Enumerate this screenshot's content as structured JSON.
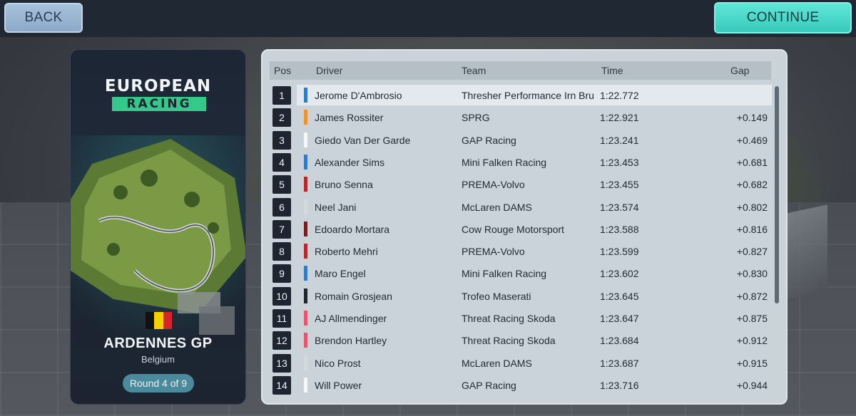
{
  "topbar": {
    "back_label": "BACK",
    "continue_label": "CONTINUE"
  },
  "event": {
    "series_line1": "EUROPEAN",
    "series_line2": "RACING",
    "gp_name": "ARDENNES GP",
    "country": "Belgium",
    "round_label": "Round 4 of 9",
    "flag_colors": [
      "#111111",
      "#f4d000",
      "#d9232b"
    ]
  },
  "results": {
    "headers": {
      "pos": "Pos",
      "driver": "Driver",
      "team": "Team",
      "time": "Time",
      "gap": "Gap"
    },
    "rows": [
      {
        "pos": "1",
        "driver": "Jerome D'Ambrosio",
        "team": "Thresher Performance Irn Bru",
        "time": "1:22.772",
        "gap": "",
        "color": "#2f7dc3"
      },
      {
        "pos": "2",
        "driver": "James Rossiter",
        "team": "SPRG",
        "time": "1:22.921",
        "gap": "+0.149",
        "color": "#f0922e"
      },
      {
        "pos": "3",
        "driver": "Giedo Van Der Garde",
        "team": "GAP Racing",
        "time": "1:23.241",
        "gap": "+0.469",
        "color": "#f4f6f7"
      },
      {
        "pos": "4",
        "driver": "Alexander Sims",
        "team": "Mini Falken Racing",
        "time": "1:23.453",
        "gap": "+0.681",
        "color": "#2f7dc3"
      },
      {
        "pos": "5",
        "driver": "Bruno Senna",
        "team": "PREMA-Volvo",
        "time": "1:23.455",
        "gap": "+0.682",
        "color": "#b22a2a"
      },
      {
        "pos": "6",
        "driver": "Neel Jani",
        "team": "McLaren DAMS",
        "time": "1:23.574",
        "gap": "+0.802",
        "color": "#d5dadd"
      },
      {
        "pos": "7",
        "driver": "Edoardo Mortara",
        "team": "Cow Rouge Motorsport",
        "time": "1:23.588",
        "gap": "+0.816",
        "color": "#7a1b1b"
      },
      {
        "pos": "8",
        "driver": "Roberto Mehri",
        "team": "PREMA-Volvo",
        "time": "1:23.599",
        "gap": "+0.827",
        "color": "#b22a2a"
      },
      {
        "pos": "9",
        "driver": "Maro Engel",
        "team": "Mini Falken Racing",
        "time": "1:23.602",
        "gap": "+0.830",
        "color": "#2f7dc3"
      },
      {
        "pos": "10",
        "driver": "Romain Grosjean",
        "team": "Trofeo Maserati",
        "time": "1:23.645",
        "gap": "+0.872",
        "color": "#1e2530"
      },
      {
        "pos": "11",
        "driver": "AJ Allmendinger",
        "team": "Threat Racing Skoda",
        "time": "1:23.647",
        "gap": "+0.875",
        "color": "#e8566a"
      },
      {
        "pos": "12",
        "driver": "Brendon Hartley",
        "team": "Threat Racing Skoda",
        "time": "1:23.684",
        "gap": "+0.912",
        "color": "#e8566a"
      },
      {
        "pos": "13",
        "driver": "Nico Prost",
        "team": "McLaren DAMS",
        "time": "1:23.687",
        "gap": "+0.915",
        "color": "#d5dadd"
      },
      {
        "pos": "14",
        "driver": "Will Power",
        "team": "GAP Racing",
        "time": "1:23.716",
        "gap": "+0.944",
        "color": "#f4f6f7"
      }
    ]
  }
}
